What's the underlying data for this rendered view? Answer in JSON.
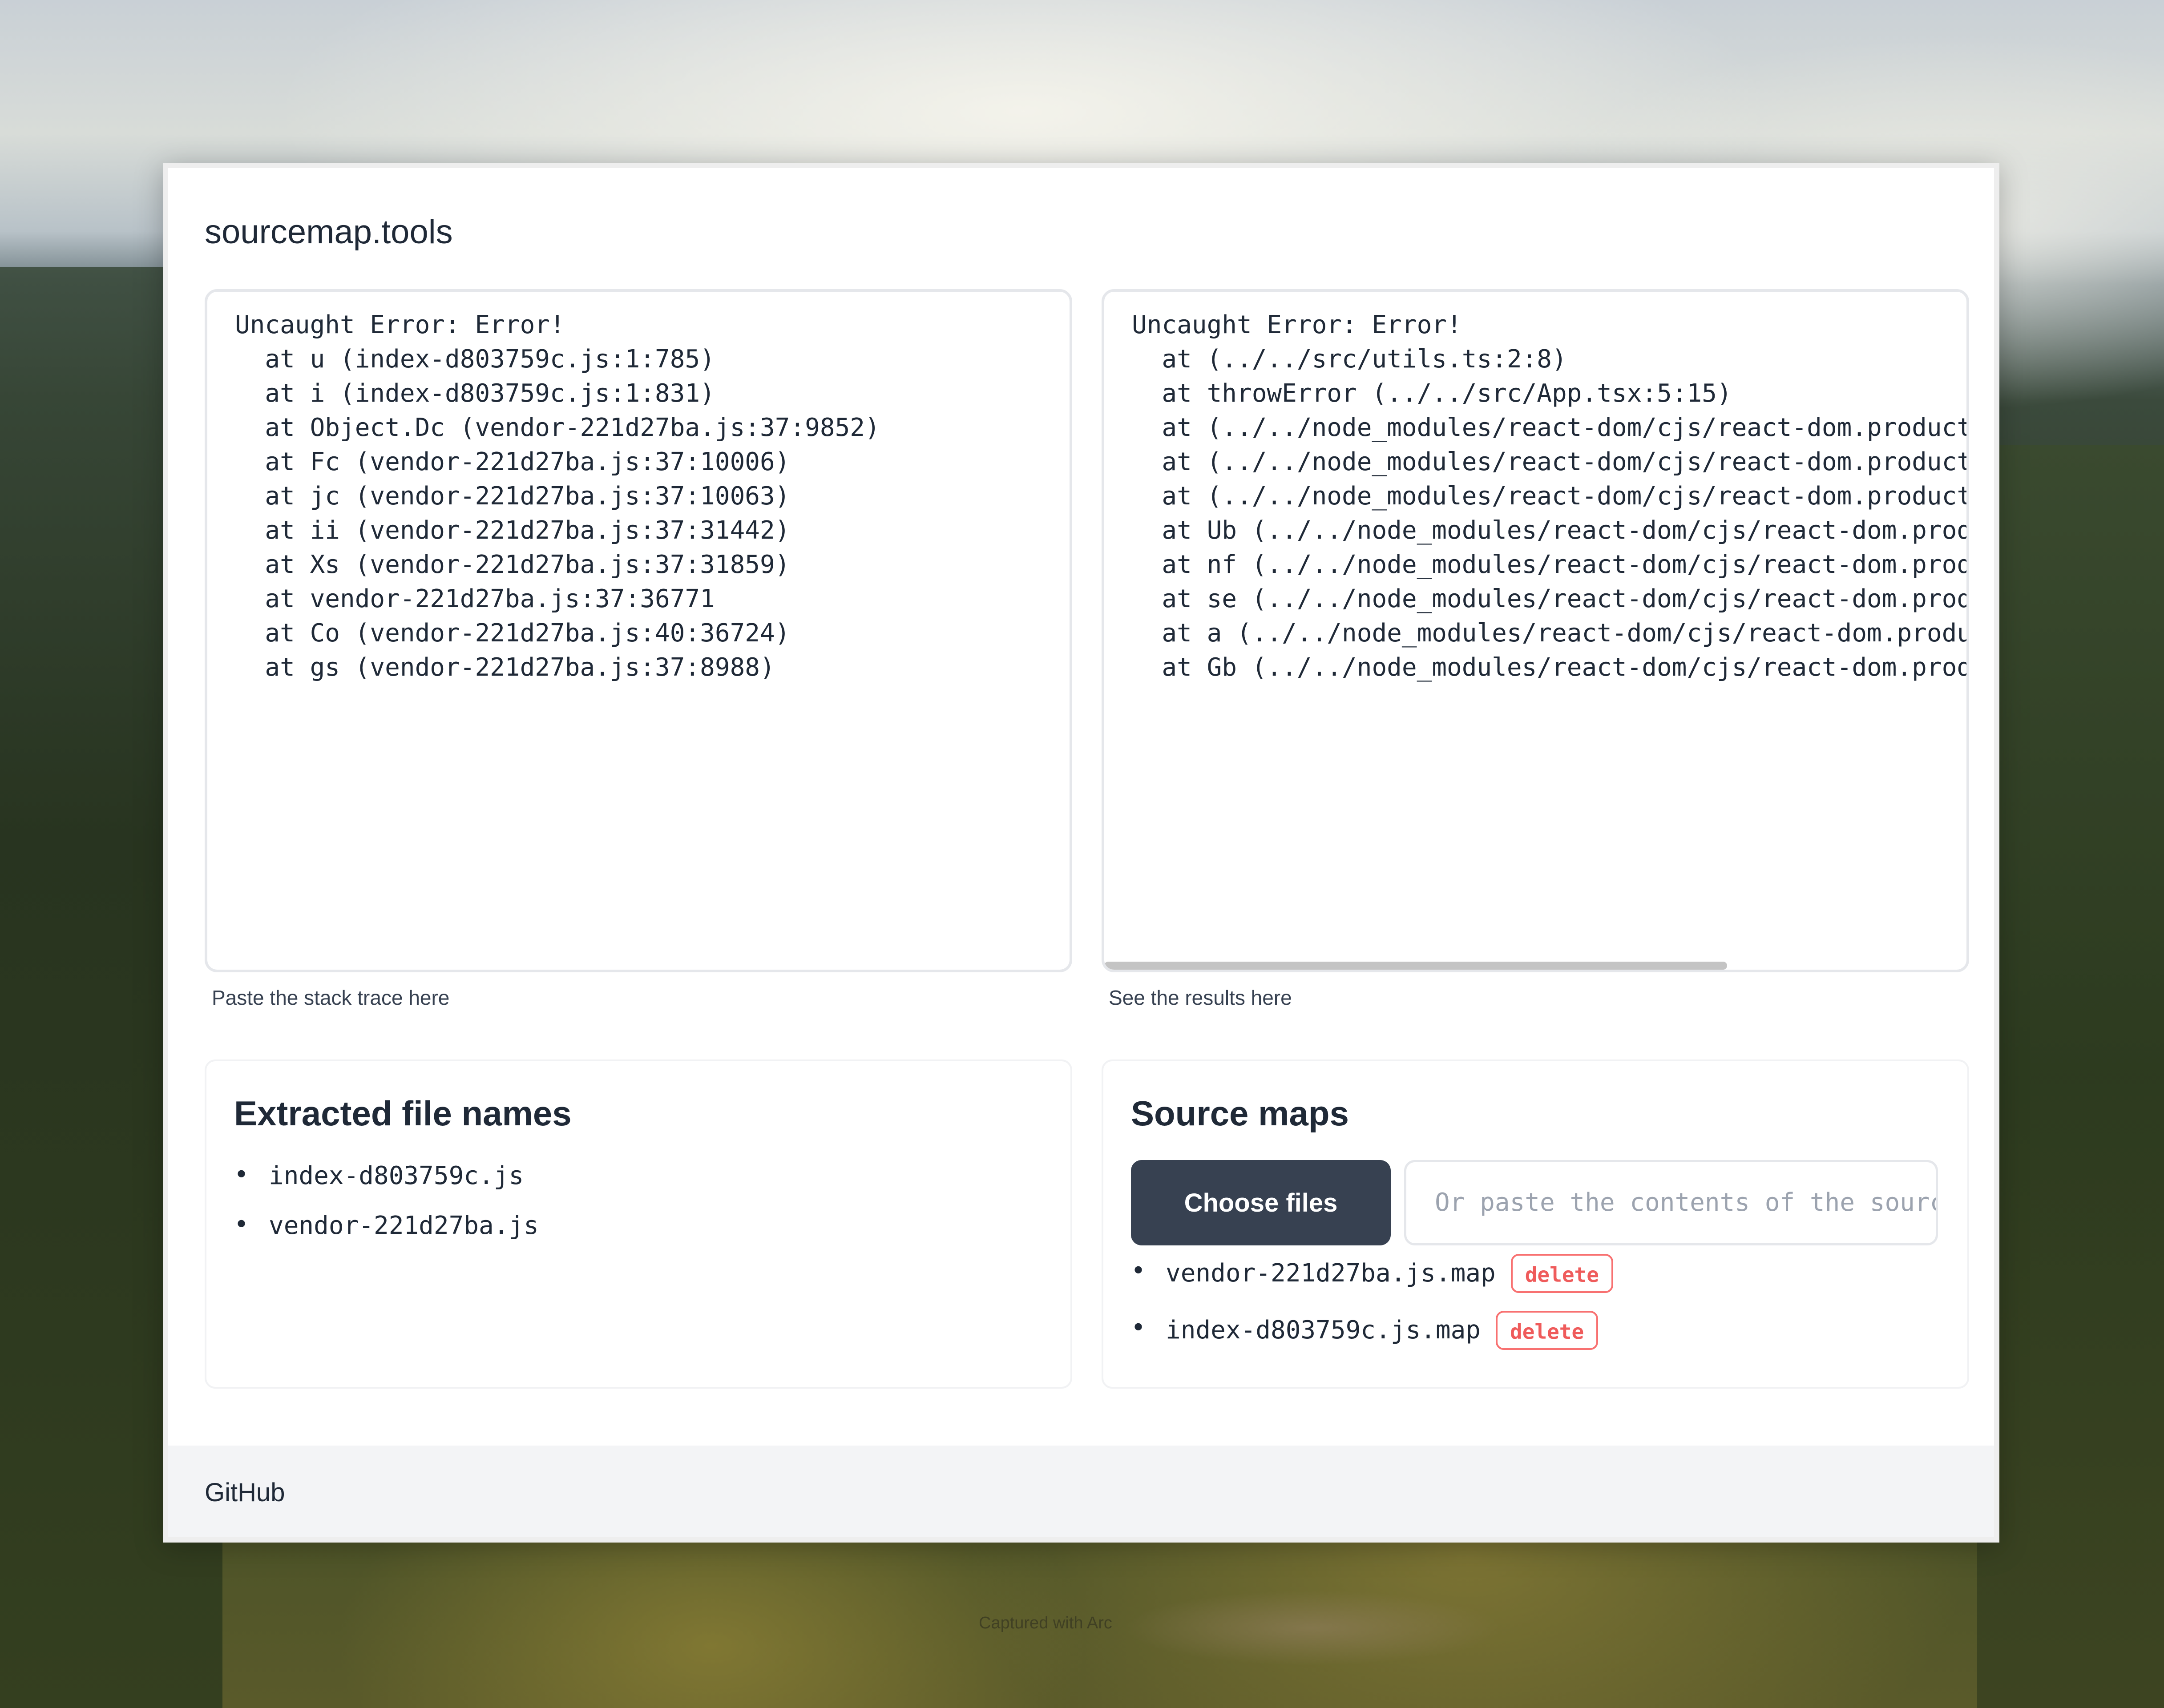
{
  "app": {
    "title": "sourcemap.tools"
  },
  "input_panel": {
    "lines": [
      "Uncaught Error: Error!",
      "  at u (index-d803759c.js:1:785)",
      "  at i (index-d803759c.js:1:831)",
      "  at Object.Dc (vendor-221d27ba.js:37:9852)",
      "  at Fc (vendor-221d27ba.js:37:10006)",
      "  at jc (vendor-221d27ba.js:37:10063)",
      "  at ii (vendor-221d27ba.js:37:31442)",
      "  at Xs (vendor-221d27ba.js:37:31859)",
      "  at vendor-221d27ba.js:37:36771",
      "  at Co (vendor-221d27ba.js:40:36724)",
      "  at gs (vendor-221d27ba.js:37:8988)"
    ],
    "caption": "Paste the stack trace here"
  },
  "output_panel": {
    "lines": [
      "Uncaught Error: Error!",
      "  at (../../src/utils.ts:2:8)",
      "  at throwError (../../src/App.tsx:5:15)",
      "  at (../../node_modules/react-dom/cjs/react-dom.product",
      "  at (../../node_modules/react-dom/cjs/react-dom.product",
      "  at (../../node_modules/react-dom/cjs/react-dom.product",
      "  at Ub (../../node_modules/react-dom/cjs/react-dom.prod",
      "  at nf (../../node_modules/react-dom/cjs/react-dom.prod",
      "  at se (../../node_modules/react-dom/cjs/react-dom.prod",
      "  at a (../../node_modules/react-dom/cjs/react-dom.produ",
      "  at Gb (../../node_modules/react-dom/cjs/react-dom.prod"
    ],
    "caption": "See the results here"
  },
  "extracted": {
    "title": "Extracted file names",
    "files": [
      "index-d803759c.js",
      "vendor-221d27ba.js"
    ]
  },
  "source_maps": {
    "title": "Source maps",
    "choose_label": "Choose files",
    "input_placeholder": "Or paste the contents of the sourc",
    "delete_label": "delete",
    "files": [
      "vendor-221d27ba.js.map",
      "index-d803759c.js.map"
    ]
  },
  "footer": {
    "link": "GitHub"
  },
  "background": {
    "watermark": "Captured with Arc"
  }
}
